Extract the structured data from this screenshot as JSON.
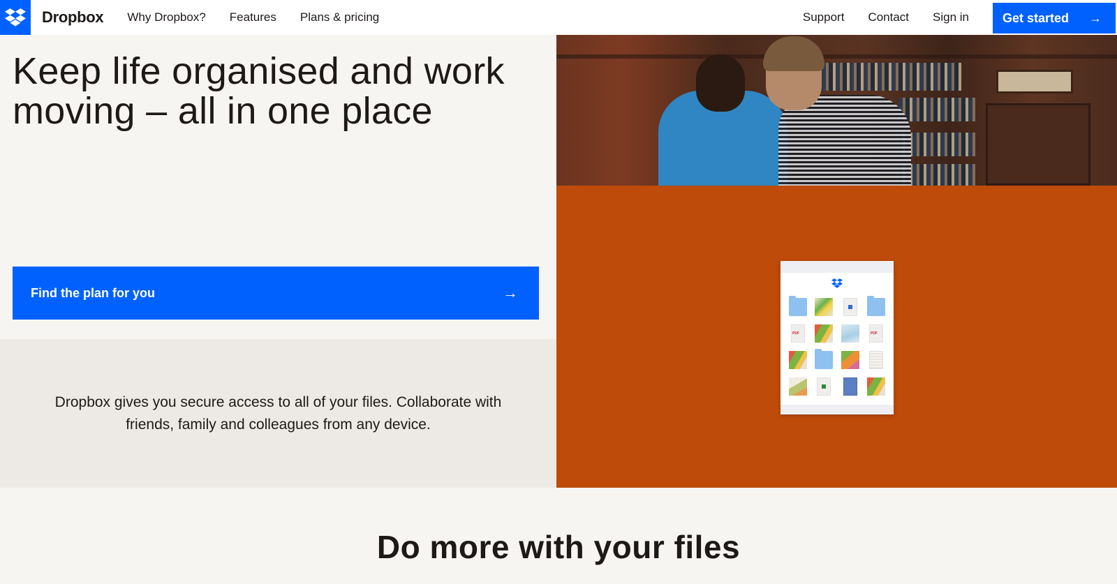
{
  "nav": {
    "brand": "Dropbox",
    "links_left": [
      "Why Dropbox?",
      "Features",
      "Plans & pricing"
    ],
    "links_right": [
      "Support",
      "Contact",
      "Sign in"
    ],
    "cta_label": "Get started",
    "cta_icon": "arrow-right-icon"
  },
  "hero": {
    "title": "Keep life organised and work moving – all in one place",
    "button_label": "Find the plan for you",
    "button_icon": "arrow-right-icon",
    "description": "Dropbox gives you secure access to all of your files. Collaborate with friends, family and colleagues from any device."
  },
  "media": {
    "photo_alt": "Two people looking at a document in a library",
    "mockup_tiles": [
      "folder",
      "image",
      "document",
      "folder",
      "pdf",
      "image",
      "image",
      "pdf",
      "image",
      "folder",
      "image",
      "spreadsheet",
      "image",
      "document",
      "document",
      "image"
    ]
  },
  "section": {
    "heading": "Do more with your files"
  },
  "colors": {
    "brand_blue": "#0061fe",
    "panel_orange": "#be4b0a",
    "background": "#f7f5f2",
    "description_bg": "#edeae5",
    "text": "#1e1919"
  }
}
